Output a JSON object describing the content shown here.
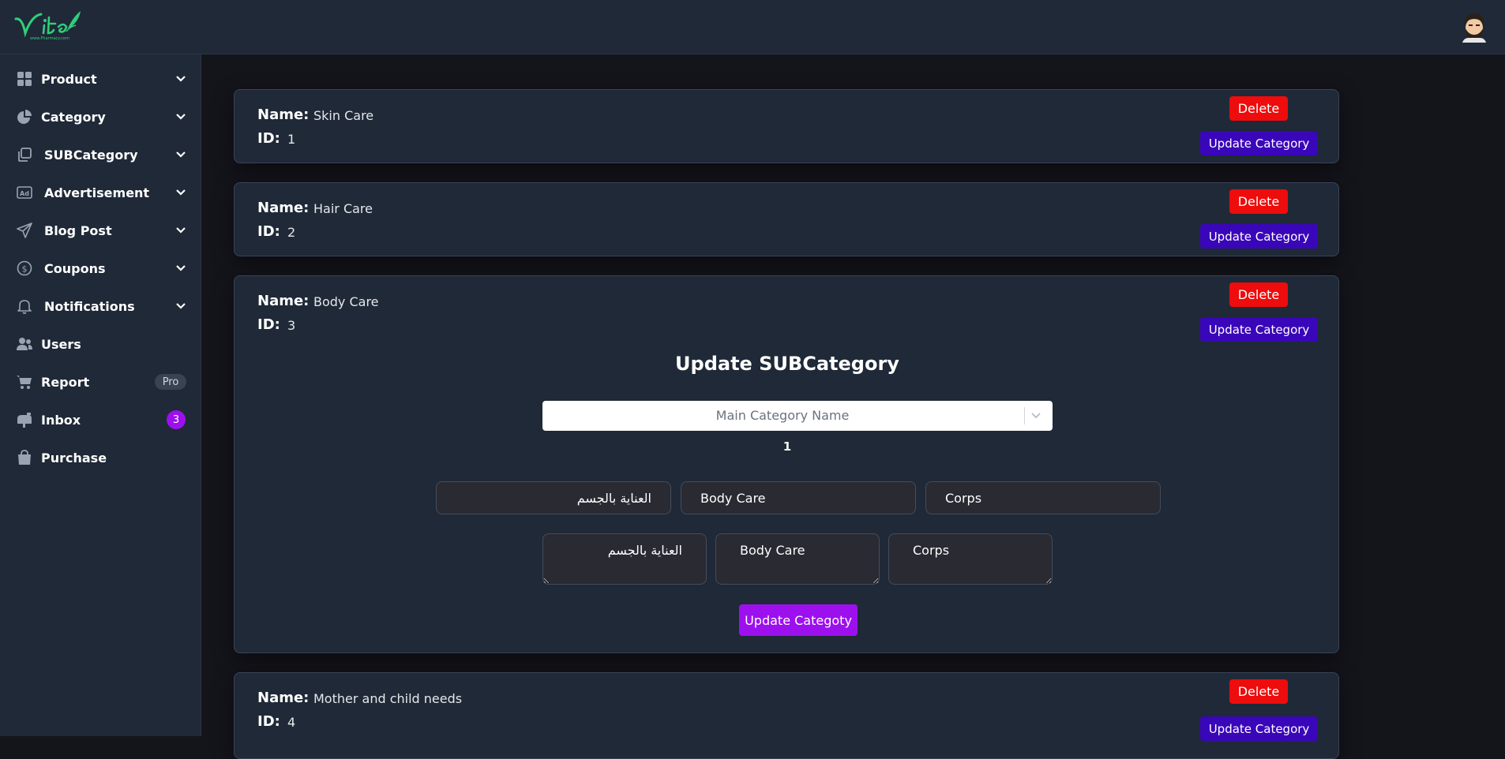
{
  "header": {
    "logo_text": "Vita",
    "logo_subtext": "www.Pharmacy.com"
  },
  "sidebar": {
    "items": [
      {
        "label": "Product",
        "icon": "grid-icon",
        "expandable": true
      },
      {
        "label": "Category",
        "icon": "pie-chart-icon",
        "expandable": true
      },
      {
        "label": "SUBCategory",
        "icon": "copy-icon",
        "expandable": true
      },
      {
        "label": "Advertisement",
        "icon": "ad-icon",
        "expandable": true
      },
      {
        "label": "Blog Post",
        "icon": "send-icon",
        "expandable": true
      },
      {
        "label": "Coupons",
        "icon": "dollar-coin-icon",
        "expandable": true
      },
      {
        "label": "Notifications",
        "icon": "bell-icon",
        "expandable": true
      },
      {
        "label": "Users",
        "icon": "users-icon",
        "expandable": false
      },
      {
        "label": "Report",
        "icon": "cart-icon",
        "expandable": false,
        "badge": "Pro"
      },
      {
        "label": "Inbox",
        "icon": "mailbox-icon",
        "expandable": false,
        "count": "3"
      },
      {
        "label": "Purchase",
        "icon": "shopping-bag-icon",
        "expandable": false
      }
    ]
  },
  "labels": {
    "name": "Name:",
    "id": "ID:",
    "delete": "Delete",
    "update_category": "Update Category"
  },
  "categories": [
    {
      "name": "Skin Care",
      "id": "1"
    },
    {
      "name": "Hair Care",
      "id": "2"
    },
    {
      "name": "Body Care",
      "id": "3"
    },
    {
      "name": "Mother and child needs",
      "id": "4"
    }
  ],
  "update_form": {
    "title": "Update SUBCategory",
    "select_placeholder": "Main Category Name",
    "selected_value": "1",
    "name_fields": [
      "العناية بالجسم",
      "Body Care",
      "Corps"
    ],
    "description_fields": [
      "العناية بالجسم",
      "Body Care",
      "Corps"
    ],
    "submit_label": "Update Categoty"
  },
  "colors": {
    "sidebar_bg": "#1f2937",
    "page_bg": "#14141b",
    "delete": "#ee0c0c",
    "update": "#3a06b9",
    "accent": "#9d10ee"
  }
}
